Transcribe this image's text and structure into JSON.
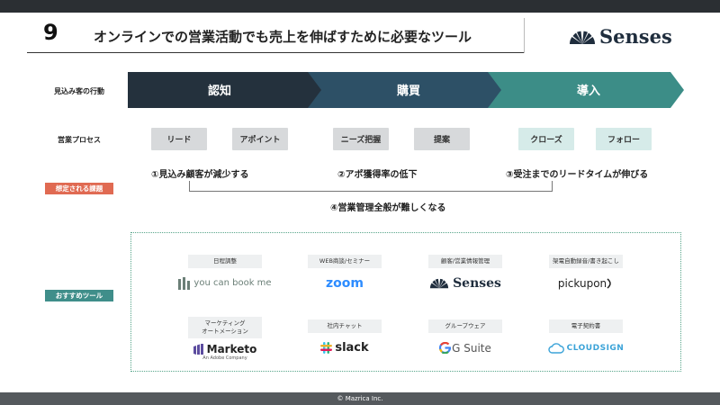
{
  "header": {
    "slide_number": "9",
    "title": "オンラインでの営業活動でも売上を伸ばすために必要なツール",
    "logo_text": "Senses"
  },
  "rows": {
    "customer_action": "見込み客の行動",
    "sales_process": "営業プロセス",
    "expected_issues": "想定される課題",
    "recommended_tools": "おすすめツール"
  },
  "stages": [
    {
      "label": "認知",
      "color": "#24313d"
    },
    {
      "label": "購買",
      "color": "#2d5066"
    },
    {
      "label": "導入",
      "color": "#3c8d87"
    }
  ],
  "process_steps": [
    {
      "label": "リード",
      "style": "gray"
    },
    {
      "label": "アポイント",
      "style": "gray"
    },
    {
      "label": "ニーズ把握",
      "style": "gray"
    },
    {
      "label": "提案",
      "style": "gray"
    },
    {
      "label": "クローズ",
      "style": "teal"
    },
    {
      "label": "フォロー",
      "style": "teal"
    }
  ],
  "issues": [
    "①見込み顧客が減少する",
    "②アポ獲得率の低下",
    "③受注までのリードタイムが伸びる"
  ],
  "issue_overall": "④営業管理全般が難しくなる",
  "tools": [
    {
      "category": "日程調整",
      "name": "you can book me",
      "icon": "ycbm-bars-icon",
      "color": "#6b7f77"
    },
    {
      "category": "WEB商談/セミナー",
      "name": "zoom",
      "icon": "zoom-wordmark",
      "color": "#2d8cff"
    },
    {
      "category": "顧客/営業情報管理",
      "name": "Senses",
      "icon": "senses-fan-icon",
      "color": "#1f2d3d"
    },
    {
      "category": "架電自動録音/書き起こし",
      "name": "pickupon",
      "icon": "pickupon-wave-icon",
      "color": "#222222"
    },
    {
      "category": "マーケティング\nオートメーション",
      "name": "Marketo",
      "sub": "An Adobe Company",
      "icon": "marketo-bars-icon",
      "color": "#5c4c9f"
    },
    {
      "category": "社内チャット",
      "name": "slack",
      "icon": "slack-hash-icon",
      "color": "#222222"
    },
    {
      "category": "グループウェア",
      "name": "G Suite",
      "icon": "google-g-icon",
      "color": "#555555"
    },
    {
      "category": "電子契約書",
      "name": "CLOUDSIGN",
      "icon": "cloud-icon",
      "color": "#3ba3d8"
    }
  ],
  "footer": "© Mazrica Inc."
}
